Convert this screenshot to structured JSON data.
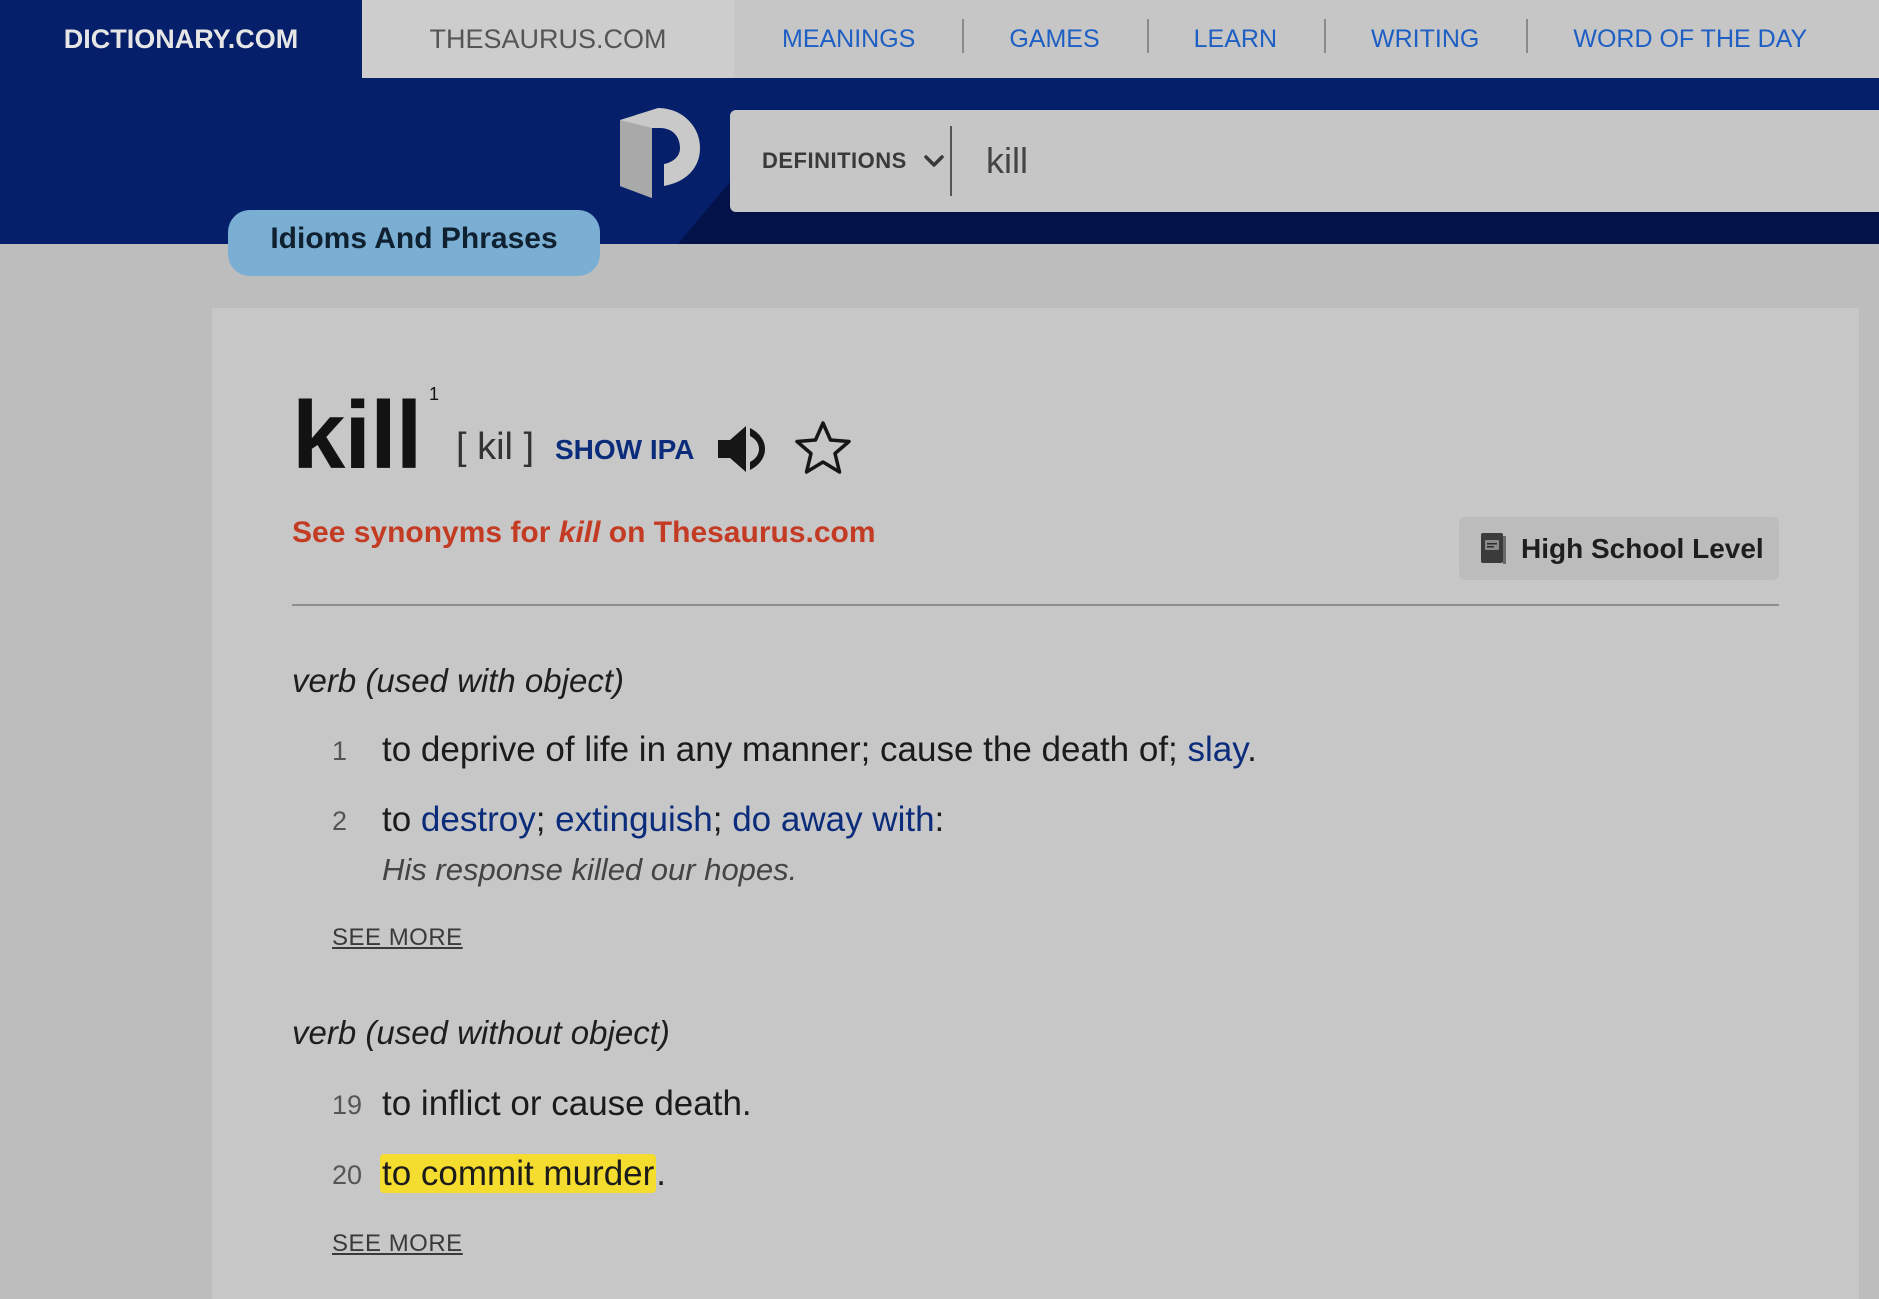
{
  "topnav": {
    "dictionary_tab": "DICTIONARY.COM",
    "thesaurus_tab": "THESAURUS.COM",
    "links": [
      "MEANINGS",
      "GAMES",
      "LEARN",
      "WRITING",
      "WORD OF THE DAY"
    ]
  },
  "search": {
    "type_label": "DEFINITIONS",
    "query": "kill"
  },
  "section_pill": "Idioms And Phrases",
  "entry": {
    "headword": "kill",
    "superscript": "1",
    "pronunciation": "[ kil ]",
    "show_ipa": "SHOW IPA",
    "synonyms_prefix": "See synonyms for ",
    "synonyms_word": "kill",
    "synonyms_suffix": " on Thesaurus.com",
    "level": "High School Level"
  },
  "senses": [
    {
      "pos": "verb (used with object)",
      "defs": [
        {
          "num": "1",
          "text_before": "to deprive of life in any manner; cause the death of; ",
          "links": [
            "slay"
          ],
          "text_after": "."
        },
        {
          "num": "2",
          "text_before": "to ",
          "links": [
            "destroy",
            "extinguish",
            "do away with"
          ],
          "sep": "; ",
          "text_after": ":",
          "example": "His response killed our hopes."
        }
      ],
      "see_more": "SEE MORE"
    },
    {
      "pos": "verb (used without object)",
      "defs": [
        {
          "num": "19",
          "text": "to inflict or cause death."
        },
        {
          "num": "20",
          "highlighted": "to commit murder",
          "text_after": "."
        }
      ],
      "see_more": "SEE MORE"
    }
  ],
  "colors": {
    "brand_navy": "#061f6b",
    "link_blue": "#0b2c7a",
    "thesaurus_red": "#c43b24",
    "highlight_yellow": "#f4dd2e"
  },
  "icons": [
    "dictionary-logo-icon",
    "chevron-down-icon",
    "speaker-icon",
    "star-icon",
    "book-icon"
  ]
}
